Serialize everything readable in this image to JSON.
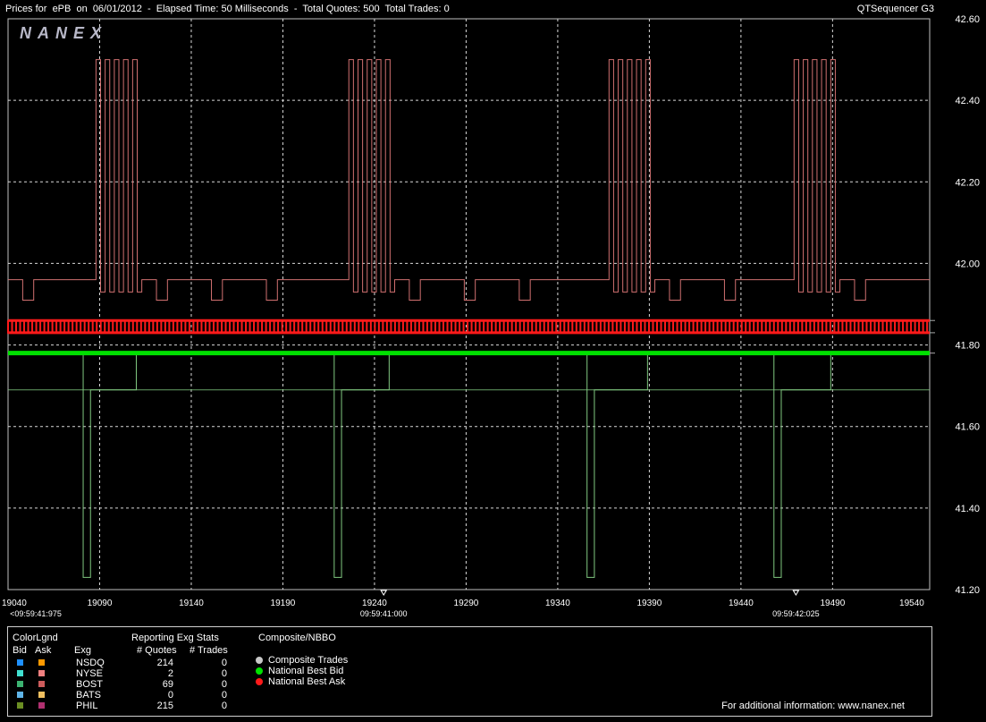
{
  "header": {
    "title": "Prices for  ePB  on  06/01/2012  -  Elapsed Time: 50 Milliseconds  -  Total Quotes: 500  Total Trades: 0",
    "app_name": "QTSequencer G3"
  },
  "watermark": "NANEX",
  "chart_data": {
    "type": "line",
    "title": "",
    "x_ticks": [
      "19040",
      "19090",
      "19140",
      "19190",
      "19240",
      "19290",
      "19340",
      "19390",
      "19440",
      "19490",
      "19540"
    ],
    "xlim": [
      19040,
      19543
    ],
    "time_labels": [
      {
        "x": 19040,
        "label": "<09:59:41:975"
      },
      {
        "x": 19245,
        "label": "09:59:41:000"
      },
      {
        "x": 19470,
        "label": "09:59:42:025"
      }
    ],
    "y_ticks": [
      "42.60",
      "42.40",
      "42.20",
      "42.00",
      "41.80",
      "41.60",
      "41.40",
      "41.20"
    ],
    "ylim": [
      41.2,
      42.6
    ],
    "grid": true,
    "series": [
      {
        "name": "National Best Bid",
        "color": "#00e000",
        "y": 41.78
      },
      {
        "name": "National Best Ask",
        "color": "#ff1a1a",
        "levels": [
          41.86,
          41.83
        ]
      },
      {
        "name": "BOST",
        "color": "#d07070",
        "bursts": [
          {
            "x0": 19088,
            "x1": 19113,
            "high": 42.5,
            "low": 41.93
          },
          {
            "x0": 19226,
            "x1": 19251,
            "high": 42.5,
            "low": 41.93
          },
          {
            "x0": 19368,
            "x1": 19393,
            "high": 42.5,
            "low": 41.93
          },
          {
            "x0": 19469,
            "x1": 19494,
            "high": 42.5,
            "low": 41.93
          }
        ],
        "base": 41.96,
        "dip": 41.91
      },
      {
        "name": "PHIL",
        "color": "#80c880",
        "drops": [
          19081,
          19218,
          19356,
          19458
        ],
        "recover": [
          19110,
          19248,
          19389,
          19489
        ],
        "base": 41.78,
        "low": 41.23,
        "mid": 41.69
      }
    ]
  },
  "legend": {
    "color_legend": "ColorLgnd",
    "bid_label": "Bid",
    "ask_label": "Ask",
    "exg_label": "Exg",
    "stats_title": "Reporting Exg Stats",
    "quotes_header": "# Quotes",
    "trades_header": "# Trades",
    "composite_title": "Composite/NBBO",
    "exchanges": [
      {
        "name": "NSDQ",
        "quotes": "214",
        "trades": "0",
        "bid": "#1e90ff",
        "ask": "#ff9900"
      },
      {
        "name": "NYSE",
        "quotes": "2",
        "trades": "0",
        "bid": "#40e0d0",
        "ask": "#f08080"
      },
      {
        "name": "BOST",
        "quotes": "69",
        "trades": "0",
        "bid": "#3cb371",
        "ask": "#cd5c5c"
      },
      {
        "name": "BATS",
        "quotes": "0",
        "trades": "0",
        "bid": "#5fb4e8",
        "ask": "#f0c060"
      },
      {
        "name": "PHIL",
        "quotes": "215",
        "trades": "0",
        "bid": "#6b8e23",
        "ask": "#b03070"
      }
    ],
    "composite": [
      {
        "label": "Composite Trades",
        "color": "#c8c8c8"
      },
      {
        "label": "National Best Bid",
        "color": "#00e000"
      },
      {
        "label": "National Best Ask",
        "color": "#ff1a1a"
      }
    ],
    "footer": "For additional information: www.nanex.net"
  }
}
